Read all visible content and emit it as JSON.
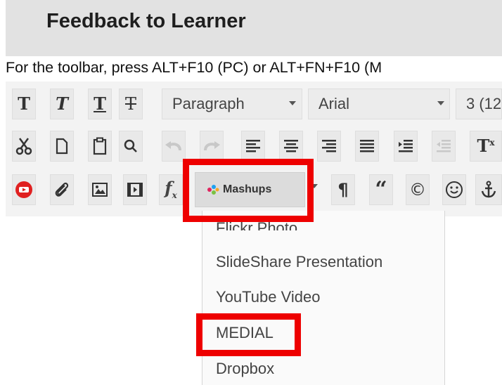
{
  "header": {
    "title": "Feedback to Learner"
  },
  "hint_text": "For the toolbar, press ALT+F10 (PC) or ALT+FN+F10 (M",
  "toolbar": {
    "format_block": "Paragraph",
    "font_family": "Arial",
    "font_size": "3 (12",
    "mashups_label": "Mashups",
    "pilcrow": "¶",
    "quote": "“",
    "copyright": "©"
  },
  "mashups_menu": {
    "items": [
      {
        "label": "Flickr Photo"
      },
      {
        "label": "SlideShare Presentation"
      },
      {
        "label": "YouTube Video"
      },
      {
        "label": "MEDIAL"
      },
      {
        "label": "Dropbox"
      }
    ],
    "highlighted_item": "MEDIAL"
  },
  "colors": {
    "highlight": "#ee0000",
    "toolbar_bg": "#f3f3f3",
    "header_bg": "#e2e2e2"
  }
}
